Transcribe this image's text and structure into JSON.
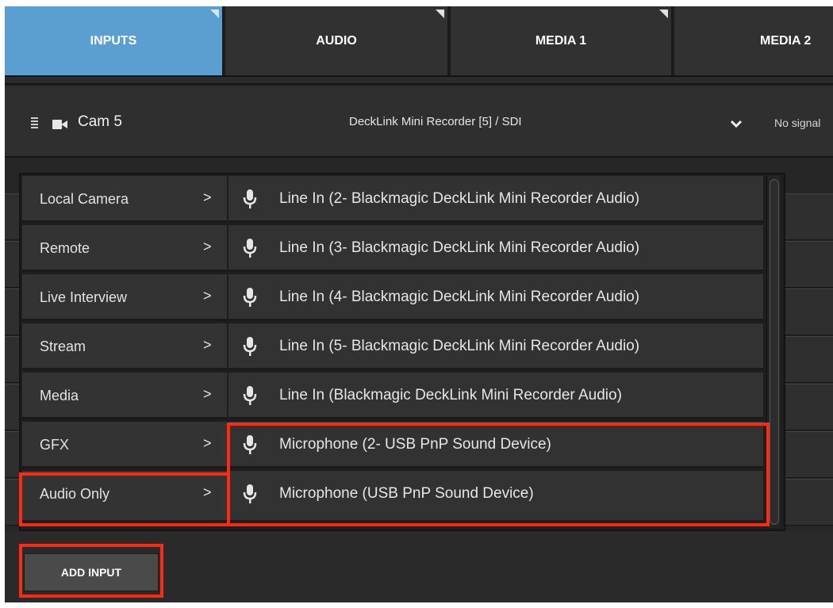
{
  "tabs": [
    {
      "label": "INPUTS",
      "active": true
    },
    {
      "label": "AUDIO",
      "active": false
    },
    {
      "label": "MEDIA 1",
      "active": false
    },
    {
      "label": "MEDIA 2",
      "active": false
    }
  ],
  "input_row": {
    "camera_name": "Cam 5",
    "source": "DeckLink Mini Recorder [5] / SDI",
    "status": "No signal"
  },
  "menu": {
    "categories": [
      {
        "label": "Local Camera"
      },
      {
        "label": "Remote"
      },
      {
        "label": "Live Interview"
      },
      {
        "label": "Stream"
      },
      {
        "label": "Media"
      },
      {
        "label": "GFX"
      },
      {
        "label": "Audio Only"
      }
    ],
    "arrow_glyph": ">",
    "items": [
      {
        "label": "Line In (2- Blackmagic DeckLink Mini Recorder Audio)",
        "icon": "microphone-icon"
      },
      {
        "label": "Line In (3- Blackmagic DeckLink Mini Recorder Audio)",
        "icon": "microphone-icon"
      },
      {
        "label": "Line In (4- Blackmagic DeckLink Mini Recorder Audio)",
        "icon": "microphone-icon"
      },
      {
        "label": "Line In (5- Blackmagic DeckLink Mini Recorder Audio)",
        "icon": "microphone-icon"
      },
      {
        "label": "Line In (Blackmagic DeckLink Mini Recorder Audio)",
        "icon": "microphone-icon"
      },
      {
        "label": "Microphone (2- USB PnP Sound Device)",
        "icon": "microphone-icon"
      },
      {
        "label": "Microphone (USB PnP Sound Device)",
        "icon": "microphone-icon"
      }
    ]
  },
  "add_input_label": "ADD INPUT",
  "colors": {
    "active_tab": "#5a9fd0",
    "highlight": "#ff2a12"
  }
}
